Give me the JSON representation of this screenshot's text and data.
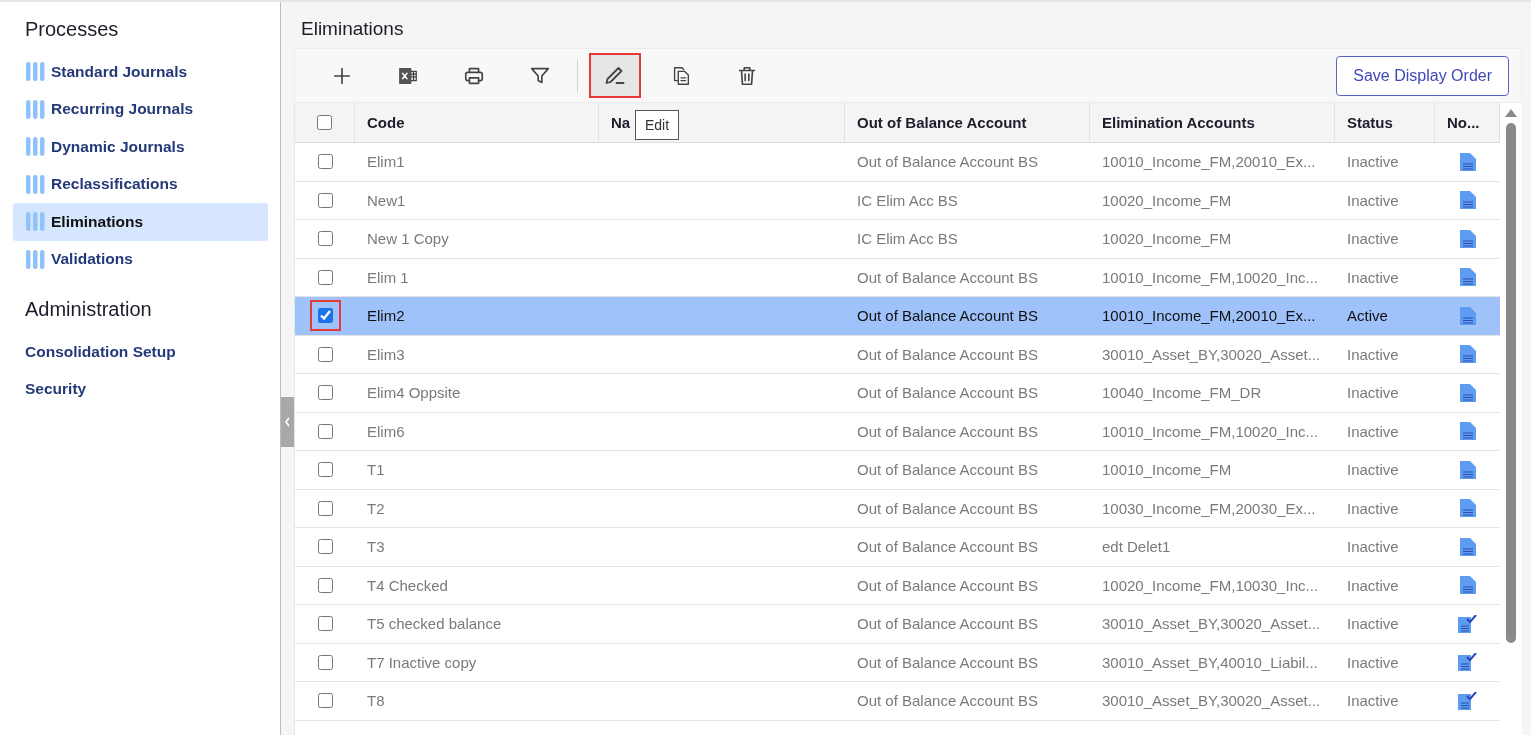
{
  "sidebar": {
    "sections": [
      {
        "title": "Processes",
        "items": [
          {
            "label": "Standard Journals",
            "kind": "process",
            "selected": false
          },
          {
            "label": "Recurring Journals",
            "kind": "process",
            "selected": false
          },
          {
            "label": "Dynamic Journals",
            "kind": "process",
            "selected": false
          },
          {
            "label": "Reclassifications",
            "kind": "process",
            "selected": false
          },
          {
            "label": "Eliminations",
            "kind": "process",
            "selected": true
          },
          {
            "label": "Validations",
            "kind": "process",
            "selected": false
          }
        ]
      },
      {
        "title": "Administration",
        "items": [
          {
            "label": "Consolidation Setup",
            "kind": "plain",
            "selected": false
          },
          {
            "label": "Security",
            "kind": "plain",
            "selected": false
          }
        ]
      }
    ]
  },
  "page": {
    "title": "Eliminations"
  },
  "toolbar": {
    "tools": [
      {
        "kind": "add",
        "selected": false
      },
      {
        "kind": "excel",
        "selected": false
      },
      {
        "kind": "print",
        "selected": false
      },
      {
        "kind": "filter",
        "selected": false
      },
      {
        "kind": "separator"
      },
      {
        "kind": "edit",
        "selected": true
      },
      {
        "kind": "copy",
        "selected": false
      },
      {
        "kind": "delete",
        "selected": false
      }
    ],
    "tooltip": "Edit",
    "save_button": "Save Display Order"
  },
  "table": {
    "select_all_checked": false,
    "columns": [
      "Code",
      "Na",
      "Out of Balance Account",
      "Elimination Accounts",
      "Status",
      "No..."
    ],
    "rows": [
      {
        "kind": "doc",
        "code": "Elim1",
        "out_of_balance": "Out of Balance Account BS",
        "elimination_accounts": "10010_Income_FM,20010_Ex...",
        "status": "Inactive",
        "checked": false,
        "selected": false
      },
      {
        "kind": "doc",
        "code": "New1",
        "out_of_balance": "IC Elim Acc BS",
        "elimination_accounts": "10020_Income_FM",
        "status": "Inactive",
        "checked": false,
        "selected": false
      },
      {
        "kind": "doc",
        "code": "New 1 Copy",
        "out_of_balance": "IC Elim Acc BS",
        "elimination_accounts": "10020_Income_FM",
        "status": "Inactive",
        "checked": false,
        "selected": false
      },
      {
        "kind": "doc",
        "code": "Elim 1",
        "out_of_balance": "Out of Balance Account BS",
        "elimination_accounts": "10010_Income_FM,10020_Inc...",
        "status": "Inactive",
        "checked": false,
        "selected": false
      },
      {
        "kind": "doc",
        "code": "Elim2",
        "out_of_balance": "Out of Balance Account BS",
        "elimination_accounts": "10010_Income_FM,20010_Ex...",
        "status": "Active",
        "checked": true,
        "selected": true
      },
      {
        "kind": "doc",
        "code": "Elim3",
        "out_of_balance": "Out of Balance Account BS",
        "elimination_accounts": "30010_Asset_BY,30020_Asset...",
        "status": "Inactive",
        "checked": false,
        "selected": false
      },
      {
        "kind": "doc",
        "code": "Elim4 Oppsite",
        "out_of_balance": "Out of Balance Account BS",
        "elimination_accounts": "10040_Income_FM_DR",
        "status": "Inactive",
        "checked": false,
        "selected": false
      },
      {
        "kind": "doc",
        "code": "Elim6",
        "out_of_balance": "Out of Balance Account BS",
        "elimination_accounts": "10010_Income_FM,10020_Inc...",
        "status": "Inactive",
        "checked": false,
        "selected": false
      },
      {
        "kind": "doc",
        "code": "T1",
        "out_of_balance": "Out of Balance Account BS",
        "elimination_accounts": "10010_Income_FM",
        "status": "Inactive",
        "checked": false,
        "selected": false
      },
      {
        "kind": "doc",
        "code": "T2",
        "out_of_balance": "Out of Balance Account BS",
        "elimination_accounts": "10030_Income_FM,20030_Ex...",
        "status": "Inactive",
        "checked": false,
        "selected": false
      },
      {
        "kind": "doc",
        "code": "T3",
        "out_of_balance": "Out of Balance Account BS",
        "elimination_accounts": "edt Delet1",
        "status": "Inactive",
        "checked": false,
        "selected": false
      },
      {
        "kind": "doc",
        "code": "T4 Checked",
        "out_of_balance": "Out of Balance Account BS",
        "elimination_accounts": "10020_Income_FM,10030_Inc...",
        "status": "Inactive",
        "checked": false,
        "selected": false
      },
      {
        "kind": "doc-check",
        "code": "T5 checked balance",
        "out_of_balance": "Out of Balance Account BS",
        "elimination_accounts": "30010_Asset_BY,30020_Asset...",
        "status": "Inactive",
        "checked": false,
        "selected": false
      },
      {
        "kind": "doc-check",
        "code": "T7 Inactive copy",
        "out_of_balance": "Out of Balance Account BS",
        "elimination_accounts": "30010_Asset_BY,40010_Liabil...",
        "status": "Inactive",
        "checked": false,
        "selected": false
      },
      {
        "kind": "doc-check",
        "code": "T8",
        "out_of_balance": "Out of Balance Account BS",
        "elimination_accounts": "30010_Asset_BY,30020_Asset...",
        "status": "Inactive",
        "checked": false,
        "selected": false
      }
    ]
  }
}
